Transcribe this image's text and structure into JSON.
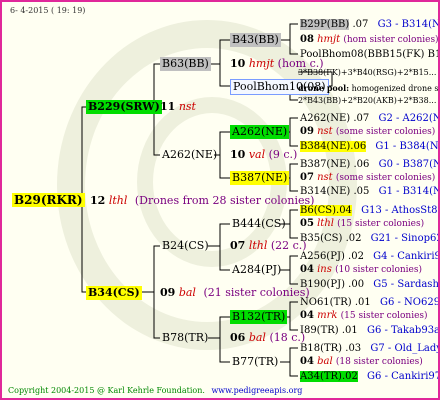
{
  "header": {
    "date": "6- 4-2015 ( 19: 19)"
  },
  "footer": {
    "copyright": "Copyright 2004-2015 @ Karl Kehrle Foundation.",
    "url": "www.pedigreeapis.org"
  },
  "root": {
    "id": "B29(RKR)",
    "gen": "12",
    "name": "lthl",
    "note": "(Drones from 28 sister colonies)"
  },
  "g1": {
    "top": {
      "id": "B229(SRW)",
      "gen": "11",
      "name": "nst"
    },
    "bottom": {
      "id": "B34(CS)",
      "gen": "09",
      "name": "bal",
      "note": "(21 sister colonies)"
    }
  },
  "g2": {
    "a": {
      "id": "B63(BB)",
      "gen": "10",
      "name": "hmjt",
      "note": "(hom c.)"
    },
    "b": {
      "id": "A262(NE)",
      "gen": "10",
      "name": "val",
      "note": "(9 c.)"
    },
    "c": {
      "id": "B24(CS)",
      "gen": "07",
      "name": "lthl",
      "note": "(22 c.)"
    },
    "d": {
      "id": "B78(TR)",
      "gen": "06",
      "name": "bal",
      "note": "(18 c.)"
    }
  },
  "g3": {
    "a1": {
      "id": "B43(BB)",
      "gen": "08",
      "name": "hmjt",
      "note": "(hom sister colonies)"
    },
    "a2": {
      "id": "PoolBhom10(08)"
    },
    "b1": {
      "id": "A262(NE)",
      "gen": "09",
      "name": "nst",
      "note": "(some sister colonies)"
    },
    "b2": {
      "id": "B387(NE)",
      "gen": "07",
      "name": "nst",
      "note": "(some sister colonies)"
    },
    "c1": {
      "id": "B444(CS)",
      "gen": "05",
      "name": "lthl",
      "note": "(15 sister colonies)"
    },
    "c2": {
      "id": "A284(PJ)",
      "gen": "04",
      "name": "ins",
      "note": "(10 sister colonies)"
    },
    "d1": {
      "id": "B132(TR)",
      "gen": "04",
      "name": "mrk",
      "note": "(15 sister colonies)"
    },
    "d2": {
      "id": "B77(TR)",
      "gen": "04",
      "name": "bal",
      "note": "(18 sister colonies)"
    }
  },
  "g4": [
    {
      "id": "B29P(BB)",
      "gen": ".07",
      "loc": "G3 - B314(NE)"
    },
    {
      "id": "PoolBhom08(BBB15(FK)",
      "gen": "",
      "loc": "B17"
    },
    {
      "id": "3*B38(FK)+3*B40(RSG)+2*B15...",
      "gen": "",
      "loc": ""
    },
    {
      "id": "drone pool:",
      "gen": "",
      "loc": "homogenized drone sperm from 1..."
    },
    {
      "id": "2*B43(BB)+2*B20(AKB)+2*B38...",
      "gen": "",
      "loc": ""
    },
    {
      "id": "A262(NE)",
      "gen": ".07",
      "loc": "G2 - A262(NE)"
    },
    {
      "id": "B384(NE)",
      "gen": ".06",
      "loc": "G1 - B384(NE)"
    },
    {
      "id": "B387(NE)",
      "gen": ".06",
      "loc": "G0 - B387(NE)"
    },
    {
      "id": "B314(NE)",
      "gen": ".05",
      "loc": "G1 - B314(NE)"
    },
    {
      "id": "B6(CS)",
      "gen": ".04",
      "loc": "G13 - AthosSt80R"
    },
    {
      "id": "B35(CS)",
      "gen": ".02",
      "loc": "G21 - Sinop62R"
    },
    {
      "id": "A256(PJ)",
      "gen": ".02",
      "loc": "G4 - Cankiri97Q"
    },
    {
      "id": "B190(PJ)",
      "gen": ".00",
      "loc": "G5 - Sardasht93R"
    },
    {
      "id": "NO61(TR)",
      "gen": ".01",
      "loc": "G6 - NO6294R"
    },
    {
      "id": "I89(TR)",
      "gen": ".01",
      "loc": "G6 - Takab93aR"
    },
    {
      "id": "B18(TR)",
      "gen": ".03",
      "loc": "G7 - Old_Lady"
    },
    {
      "id": "A34(TR)",
      "gen": ".02",
      "loc": "G6 - Cankiri97Q"
    }
  ]
}
